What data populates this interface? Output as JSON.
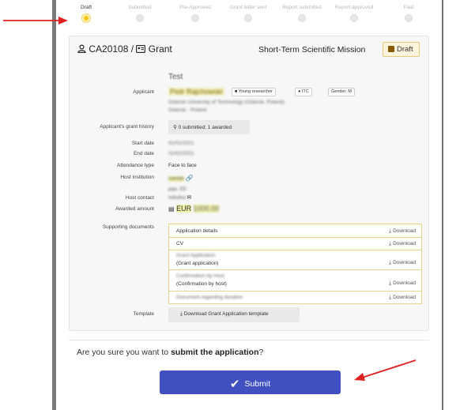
{
  "steps": [
    {
      "label": "Draft",
      "active": true
    },
    {
      "label": "Submitted",
      "active": false
    },
    {
      "label": "Pre-Approved",
      "active": false
    },
    {
      "label": "Grant letter sent",
      "active": false
    },
    {
      "label": "Report submitted",
      "active": false
    },
    {
      "label": "Report approved",
      "active": false
    },
    {
      "label": "Paid",
      "active": false
    }
  ],
  "header": {
    "id_text": "CA20108 / ",
    "type_label": "Grant",
    "mission": "Short-Term Scientific Mission",
    "status_button": "Draft"
  },
  "details": {
    "title": "Test",
    "applicant_label": "Applicant",
    "applicant_name": "Piotr Rajchowski",
    "tags": [
      "Young researcher",
      "ITC",
      "Gender: M"
    ],
    "applicant_org_1": "Gdansk University of Technology (Gdansk, Poland)",
    "applicant_org_2": "Gdansk - Poland",
    "history_label": "Applicant's grant history",
    "history_button": "0 submitted; 1 awarded",
    "start_label": "Start date",
    "start_value": "01/01/2021",
    "end_label": "End date",
    "end_value": "01/02/2021",
    "attendance_label": "Attendance type",
    "attendance_value": "Face to face",
    "host_inst_label": "Host institution",
    "host_inst_value": "hdhfdh",
    "host_contact_label": "Host contact",
    "host_contact_value_1": "ppp, EE",
    "host_contact_value_2": "hdhdhd",
    "awarded_label": "Awarded amount",
    "awarded_currency": "EUR",
    "awarded_value": "1000.00",
    "docs_label": "Supporting documents",
    "template_label": "Template",
    "template_button": "Download Grant Application template"
  },
  "documents": [
    {
      "name": "Application details",
      "sub": "",
      "blurred": false,
      "action": "Download"
    },
    {
      "name": "CV",
      "sub": "",
      "blurred": false,
      "action": "Download"
    },
    {
      "name": "Grant Application",
      "sub": "(Grant application)",
      "blurred": true,
      "action": "Download"
    },
    {
      "name": "Confirmation by Host",
      "sub": "(Confirmation by host)",
      "blurred": true,
      "action": "Download"
    },
    {
      "name": "Document regarding duration",
      "sub": "",
      "blurred": true,
      "action": "Download"
    }
  ],
  "confirm": {
    "prefix": "Are you sure you want to ",
    "bold": "submit the application",
    "suffix": "?"
  },
  "submit_label": "Submit",
  "colors": {
    "primary": "#4050c0",
    "draft_accent": "#f5c518",
    "annotation_arrow": "#e02020"
  }
}
